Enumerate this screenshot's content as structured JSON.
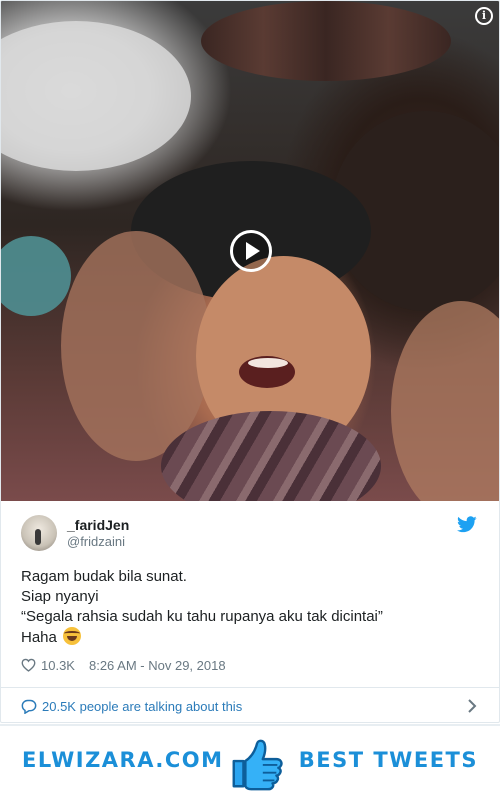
{
  "tweet": {
    "display_name": "_faridJen",
    "handle": "@fridzaini",
    "text_lines": [
      "Ragam budak bila sunat.",
      "Siap nyanyi",
      "“Segala rahsia sudah ku tahu rupanya aku tak dicintai”",
      "Haha"
    ],
    "likes": "10.3K",
    "timestamp": "8:26 AM - Nov 29, 2018",
    "talking": "20.5K people are talking about this"
  },
  "media": {
    "type": "video",
    "play_icon": "play-icon",
    "info_icon": "info-icon",
    "info_glyph": "i"
  },
  "icons": {
    "bird": "twitter-bird-icon",
    "heart": "heart-icon",
    "bubble": "speech-bubble-icon",
    "chevron": "chevron-right-icon",
    "emoji": "face-with-tears-of-joy-emoji"
  },
  "banner": {
    "left_text": "ELWIZARA.COM",
    "right_text": "BEST TWEETS",
    "icon": "thumbs-up-icon"
  },
  "colors": {
    "twitter_blue": "#1da1f2",
    "link_blue": "#2b7bb9",
    "brand_blue": "#1b8fd8",
    "text_dark": "#1c2022",
    "text_grey": "#697882"
  }
}
